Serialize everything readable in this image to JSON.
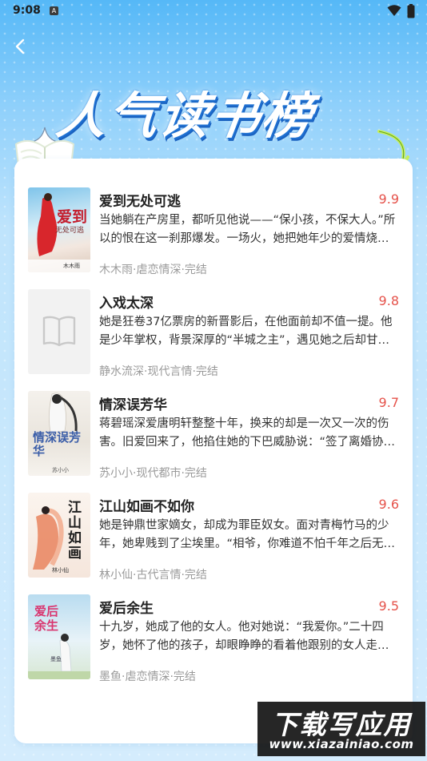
{
  "status_bar": {
    "time": "9:08",
    "a_icon": "A"
  },
  "banner": {
    "title": "人气读书榜"
  },
  "colors": {
    "score": "#e5524a",
    "accent": "#3d9df0"
  },
  "books": [
    {
      "title": "爱到无处可逃",
      "score": "9.9",
      "desc": "当她躺在产房里，都听见他说——“保小孩，不保大人。”所以的恨在这一刹那爆发。一场火，她把她年少的爱情烧得干干净净。",
      "meta": "木木雨·虐恋情深·完结",
      "cover": {
        "type": "image",
        "text_big": "爱到",
        "text_small": "无处可逃",
        "author": "木木雨"
      }
    },
    {
      "title": "入戏太深",
      "score": "9.8",
      "desc": "她是狂卷37亿票房的新晋影后，在他面前却不值一提。他是少年掌权，背景深厚的“半城之主”，遇见她之后却甘愿入戏。",
      "meta": "静水流深·现代言情·完结",
      "cover": {
        "type": "placeholder",
        "icon": "book-icon"
      }
    },
    {
      "title": "情深误芳华",
      "score": "9.7",
      "desc": "蒋碧瑶深爱唐明轩整整十年，换来的却是一次又一次的伤害。旧爱回来了，他掐住她的下巴威胁说：“签了离婚协议。”",
      "meta": "苏小小·现代都市·完结",
      "cover": {
        "type": "image",
        "text_big": "情深误芳华",
        "author": "苏小小"
      }
    },
    {
      "title": "江山如画不如你",
      "score": "9.6",
      "desc": "她是钟鼎世家嫡女，却成为罪臣奴女。面对青梅竹马的少年，她卑贱到了尘埃里。“相爷，你难道不怕千年之后无人记得？”",
      "meta": "林小仙·古代言情·完结",
      "cover": {
        "type": "image",
        "text_big": "江山如画",
        "author": "林小仙"
      }
    },
    {
      "title": "爱后余生",
      "score": "9.5",
      "desc": "十九岁，她成了他的女人。他对她说：“我爱你。”二十四岁，她怀了他的孩子，却眼睁睁的看着他跟别的女人走进婚姻。",
      "meta": "墨鱼·虐恋情深·完结",
      "cover": {
        "type": "image",
        "text_big": "爱后余生",
        "author": "墨鱼"
      }
    }
  ],
  "watermark": {
    "title": "下载写应用",
    "url": "www.xiazainiao.com"
  }
}
